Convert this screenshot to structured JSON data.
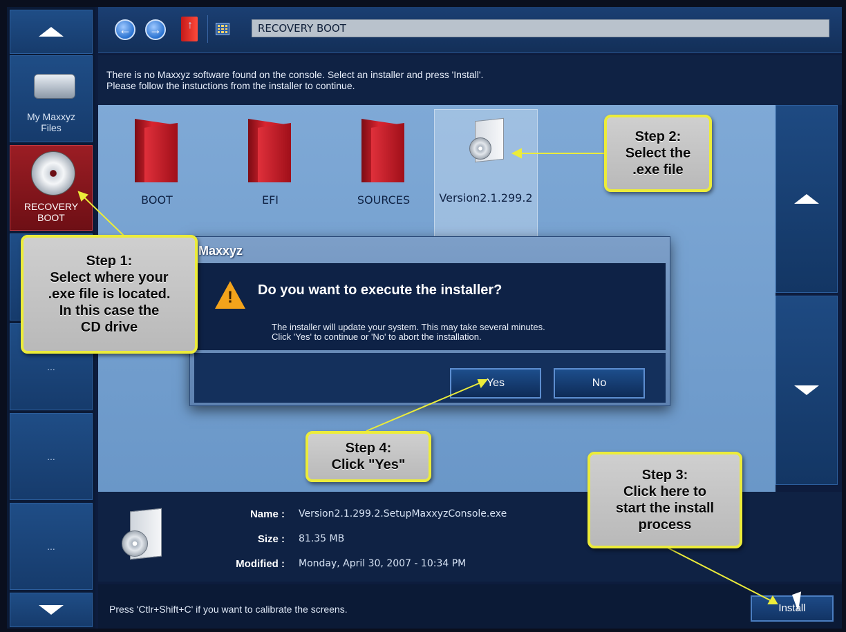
{
  "toolbar": {
    "back_glyph": "←",
    "forward_glyph": "→",
    "up_glyph": "↑",
    "path": "RECOVERY BOOT"
  },
  "info": {
    "line1": "There is no Maxxyz software found on the console. Select an installer and press 'Install'.",
    "line2": "Please follow the instuctions from the installer to continue."
  },
  "sidebar": {
    "my_files_line1": "My Maxxyz",
    "my_files_line2": "Files",
    "recovery_line1": "RECOVERY",
    "recovery_line2": "BOOT",
    "empty_label": "..."
  },
  "files": [
    {
      "name": "BOOT",
      "icon": "folder-icon"
    },
    {
      "name": "EFI",
      "icon": "folder-icon"
    },
    {
      "name": "SOURCES",
      "icon": "folder-icon"
    },
    {
      "name": "Version2.1.299.2",
      "icon": "installer-icon",
      "selected": true
    }
  ],
  "dialog": {
    "title": "Maxxyz",
    "question": "Do you want to execute the installer?",
    "text1": "The installer will update your system. This may take several minutes.",
    "text2": "Click 'Yes' to continue or 'No' to abort the installation.",
    "yes": "Yes",
    "no": "No"
  },
  "details": {
    "name_label": "Name :",
    "name_value": "Version2.1.299.2.SetupMaxxyzConsole.exe",
    "size_label": "Size :",
    "size_value": "81.35 MB",
    "modified_label": "Modified :",
    "modified_value": "Monday, April 30, 2007  -  10:34 PM"
  },
  "status": {
    "text": "Press 'Ctlr+Shift+C' if you want to calibrate the screens.",
    "install_label": "Install"
  },
  "annotations": {
    "step1": [
      "Step 1:",
      "Select where your",
      ".exe file is located.",
      "In this case the",
      "CD drive"
    ],
    "step2": [
      "Step 2:",
      "Select the",
      ".exe file"
    ],
    "step3": [
      "Step 3:",
      "Click here to",
      "start the install",
      "process"
    ],
    "step4": [
      "Step 4:",
      "Click \"Yes\""
    ],
    "highlight_color": "#ecec3a"
  }
}
